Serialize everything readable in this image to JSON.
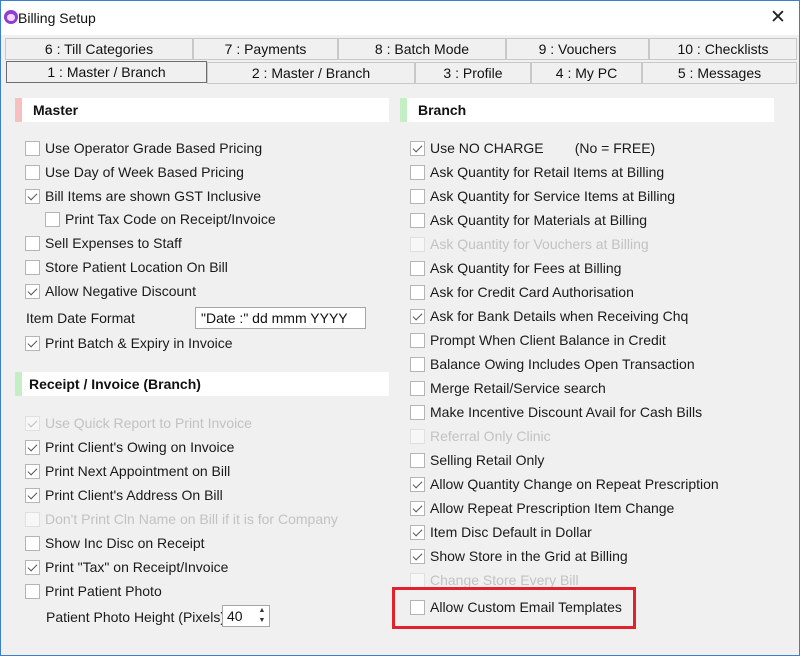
{
  "window": {
    "title": "Billing Setup",
    "close_glyph": "✕"
  },
  "tabs": {
    "row1": [
      {
        "label": "6 : Till Categories"
      },
      {
        "label": "7 : Payments"
      },
      {
        "label": "8 : Batch Mode"
      },
      {
        "label": "9 : Vouchers"
      },
      {
        "label": "10 : Checklists"
      }
    ],
    "row2": [
      {
        "label": "1 : Master / Branch",
        "active": true
      },
      {
        "label": "2 : Master / Branch"
      },
      {
        "label": "3 : Profile"
      },
      {
        "label": "4 : My PC"
      },
      {
        "label": "5 : Messages"
      }
    ]
  },
  "master": {
    "title": "Master",
    "accent_color": "#f6c0c0",
    "items": [
      {
        "label": "Use Operator Grade Based Pricing",
        "checked": false
      },
      {
        "label": "Use Day of Week Based Pricing",
        "checked": false
      },
      {
        "label": "Bill Items are shown GST Inclusive",
        "checked": true
      },
      {
        "label": "Print Tax Code on Receipt/Invoice",
        "checked": false
      },
      {
        "label": "Sell Expenses to Staff",
        "checked": false
      },
      {
        "label": "Store Patient Location On Bill",
        "checked": false
      },
      {
        "label": "Allow Negative Discount",
        "checked": true
      }
    ],
    "item_date_format_label": "Item Date Format",
    "item_date_format_value": "\"Date :\" dd mmm YYYY",
    "print_batch": {
      "label": "Print Batch & Expiry in Invoice",
      "checked": true
    }
  },
  "receipt": {
    "title": "Receipt / Invoice (Branch)",
    "accent_color": "#c4efc4",
    "items": [
      {
        "label": "Use Quick Report to Print Invoice",
        "checked": true,
        "disabled": true
      },
      {
        "label": "Print Client's Owing on Invoice",
        "checked": true
      },
      {
        "label": "Print Next Appointment on Bill",
        "checked": true
      },
      {
        "label": "Print Client's Address On Bill",
        "checked": true
      },
      {
        "label": "Don't Print Cln Name on Bill if it is for Company",
        "checked": false,
        "disabled": true
      },
      {
        "label": "Show Inc Disc on Receipt",
        "checked": false
      },
      {
        "label": "Print \"Tax\" on Receipt/Invoice",
        "checked": true
      },
      {
        "label": "Print Patient Photo",
        "checked": false
      }
    ],
    "photo_height_label": "Patient Photo Height (Pixels)",
    "photo_height_value": "40",
    "spin_up": "▲",
    "spin_down": "▼"
  },
  "branch": {
    "title": "Branch",
    "accent_color": "#c4efc4",
    "items": [
      {
        "label": "Use NO CHARGE        (No = FREE)",
        "checked": true
      },
      {
        "label": "Ask Quantity for Retail Items at Billing",
        "checked": false
      },
      {
        "label": "Ask Quantity for Service Items at Billing",
        "checked": false
      },
      {
        "label": "Ask Quantity for Materials at Billing",
        "checked": false
      },
      {
        "label": "Ask Quantity for Vouchers at Billing",
        "checked": false,
        "disabled": true
      },
      {
        "label": "Ask Quantity for Fees at Billing",
        "checked": false
      },
      {
        "label": "Ask for Credit Card Authorisation",
        "checked": false
      },
      {
        "label": "Ask for Bank Details when Receiving Chq",
        "checked": true
      },
      {
        "label": "Prompt When Client Balance in Credit",
        "checked": false
      },
      {
        "label": "Balance Owing Includes Open Transaction",
        "checked": false
      },
      {
        "label": "Merge Retail/Service search",
        "checked": false
      },
      {
        "label": "Make Incentive Discount Avail for Cash Bills",
        "checked": false
      },
      {
        "label": "Referral Only Clinic",
        "checked": false,
        "disabled": true
      },
      {
        "label": "Selling Retail Only",
        "checked": false
      },
      {
        "label": "Allow Quantity Change on Repeat Prescription",
        "checked": true
      },
      {
        "label": "Allow Repeat Prescription Item Change",
        "checked": true
      },
      {
        "label": "Item Disc Default in Dollar",
        "checked": true
      },
      {
        "label": "Show Store in the Grid at Billing",
        "checked": true
      },
      {
        "label": "Change Store Every Bill",
        "checked": false,
        "disabled": true
      },
      {
        "label": "Allow Custom Email Templates",
        "checked": false
      }
    ]
  },
  "highlight_color": "#e0222b"
}
